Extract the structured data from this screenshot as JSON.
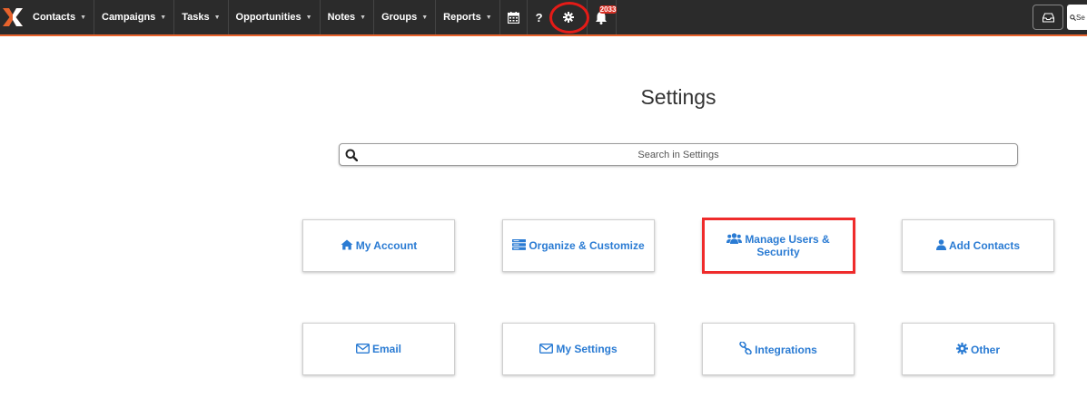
{
  "nav": {
    "items": [
      {
        "label": "Contacts"
      },
      {
        "label": "Campaigns"
      },
      {
        "label": "Tasks"
      },
      {
        "label": "Opportunities"
      },
      {
        "label": "Notes"
      },
      {
        "label": "Groups"
      },
      {
        "label": "Reports"
      }
    ],
    "help_label": "?",
    "notification_count": "2033",
    "search_placeholder": "Se"
  },
  "page": {
    "title": "Settings",
    "search_placeholder": "Search in Settings"
  },
  "cards": [
    {
      "label": "My Account",
      "icon": "home-icon"
    },
    {
      "label": "Organize & Customize",
      "icon": "server-icon"
    },
    {
      "label": "Manage Users & Security",
      "icon": "users-icon"
    },
    {
      "label": "Add Contacts",
      "icon": "user-icon"
    },
    {
      "label": "Email",
      "icon": "envelope-icon"
    },
    {
      "label": "My Settings",
      "icon": "envelope-icon"
    },
    {
      "label": "Integrations",
      "icon": "link-icon"
    },
    {
      "label": "Other",
      "icon": "gear-icon"
    }
  ],
  "colors": {
    "nav_bg": "#2b2b2b",
    "accent": "#e8632c",
    "link_blue": "#2a7bd3",
    "highlight_red": "#ef2b2b"
  }
}
